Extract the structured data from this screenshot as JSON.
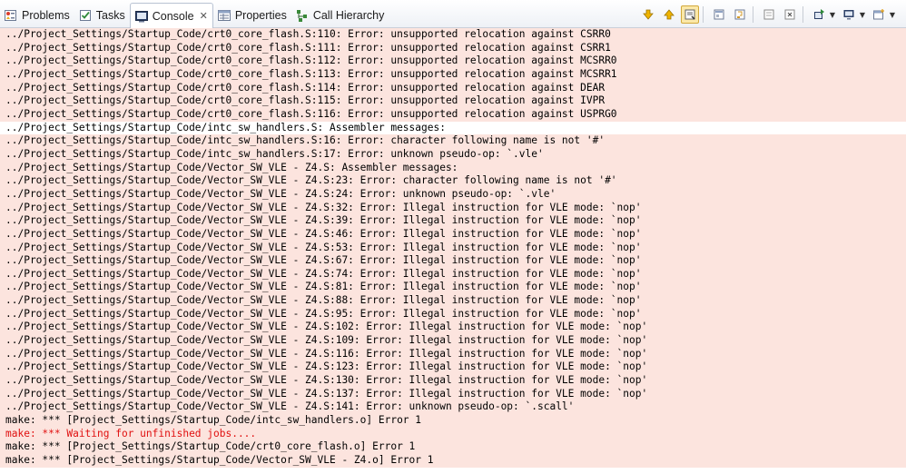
{
  "tabs": [
    {
      "label": "Problems",
      "icon": "problems-icon"
    },
    {
      "label": "Tasks",
      "icon": "tasks-icon"
    },
    {
      "label": "Console",
      "icon": "console-icon",
      "active": true,
      "close": "✕"
    },
    {
      "label": "Properties",
      "icon": "properties-icon"
    },
    {
      "label": "Call Hierarchy",
      "icon": "call-hierarchy-icon"
    }
  ],
  "toolbar": {
    "icons": [
      "scroll-down-icon",
      "scroll-up-icon",
      "scroll-lock-icon",
      "pin-console-icon",
      "word-wrap-icon",
      "clear-console-icon",
      "terminate-icon",
      "open-console-icon",
      "display-console-icon",
      "new-console-icon"
    ]
  },
  "colors": {
    "error_background": "#fce4de",
    "stderr_text": "#e01010",
    "accent": "#d2a93a"
  },
  "console": {
    "lines": [
      {
        "text": "../Project_Settings/Startup_Code/crt0_core_flash.S:110: Error: unsupported relocation against CSRR0",
        "bg": true
      },
      {
        "text": "../Project_Settings/Startup_Code/crt0_core_flash.S:111: Error: unsupported relocation against CSRR1",
        "bg": true
      },
      {
        "text": "../Project_Settings/Startup_Code/crt0_core_flash.S:112: Error: unsupported relocation against MCSRR0",
        "bg": true
      },
      {
        "text": "../Project_Settings/Startup_Code/crt0_core_flash.S:113: Error: unsupported relocation against MCSRR1",
        "bg": true
      },
      {
        "text": "../Project_Settings/Startup_Code/crt0_core_flash.S:114: Error: unsupported relocation against DEAR",
        "bg": true
      },
      {
        "text": "../Project_Settings/Startup_Code/crt0_core_flash.S:115: Error: unsupported relocation against IVPR",
        "bg": true
      },
      {
        "text": "../Project_Settings/Startup_Code/crt0_core_flash.S:116: Error: unsupported relocation against USPRG0",
        "bg": true
      },
      {
        "text": "../Project_Settings/Startup_Code/intc_sw_handlers.S: Assembler messages:",
        "bg": false
      },
      {
        "text": "../Project_Settings/Startup_Code/intc_sw_handlers.S:16: Error: character following name is not '#'",
        "bg": true
      },
      {
        "text": "../Project_Settings/Startup_Code/intc_sw_handlers.S:17: Error: unknown pseudo-op: `.vle'",
        "bg": true
      },
      {
        "text": "../Project_Settings/Startup_Code/Vector_SW_VLE - Z4.S: Assembler messages:",
        "bg": true
      },
      {
        "text": "../Project_Settings/Startup_Code/Vector_SW_VLE - Z4.S:23: Error: character following name is not '#'",
        "bg": true
      },
      {
        "text": "../Project_Settings/Startup_Code/Vector_SW_VLE - Z4.S:24: Error: unknown pseudo-op: `.vle'",
        "bg": true
      },
      {
        "text": "../Project_Settings/Startup_Code/Vector_SW_VLE - Z4.S:32: Error: Illegal instruction for VLE mode: `nop'",
        "bg": true
      },
      {
        "text": "../Project_Settings/Startup_Code/Vector_SW_VLE - Z4.S:39: Error: Illegal instruction for VLE mode: `nop'",
        "bg": true
      },
      {
        "text": "../Project_Settings/Startup_Code/Vector_SW_VLE - Z4.S:46: Error: Illegal instruction for VLE mode: `nop'",
        "bg": true
      },
      {
        "text": "../Project_Settings/Startup_Code/Vector_SW_VLE - Z4.S:53: Error: Illegal instruction for VLE mode: `nop'",
        "bg": true
      },
      {
        "text": "../Project_Settings/Startup_Code/Vector_SW_VLE - Z4.S:67: Error: Illegal instruction for VLE mode: `nop'",
        "bg": true
      },
      {
        "text": "../Project_Settings/Startup_Code/Vector_SW_VLE - Z4.S:74: Error: Illegal instruction for VLE mode: `nop'",
        "bg": true
      },
      {
        "text": "../Project_Settings/Startup_Code/Vector_SW_VLE - Z4.S:81: Error: Illegal instruction for VLE mode: `nop'",
        "bg": true
      },
      {
        "text": "../Project_Settings/Startup_Code/Vector_SW_VLE - Z4.S:88: Error: Illegal instruction for VLE mode: `nop'",
        "bg": true
      },
      {
        "text": "../Project_Settings/Startup_Code/Vector_SW_VLE - Z4.S:95: Error: Illegal instruction for VLE mode: `nop'",
        "bg": true
      },
      {
        "text": "../Project_Settings/Startup_Code/Vector_SW_VLE - Z4.S:102: Error: Illegal instruction for VLE mode: `nop'",
        "bg": true
      },
      {
        "text": "../Project_Settings/Startup_Code/Vector_SW_VLE - Z4.S:109: Error: Illegal instruction for VLE mode: `nop'",
        "bg": true
      },
      {
        "text": "../Project_Settings/Startup_Code/Vector_SW_VLE - Z4.S:116: Error: Illegal instruction for VLE mode: `nop'",
        "bg": true
      },
      {
        "text": "../Project_Settings/Startup_Code/Vector_SW_VLE - Z4.S:123: Error: Illegal instruction for VLE mode: `nop'",
        "bg": true
      },
      {
        "text": "../Project_Settings/Startup_Code/Vector_SW_VLE - Z4.S:130: Error: Illegal instruction for VLE mode: `nop'",
        "bg": true
      },
      {
        "text": "../Project_Settings/Startup_Code/Vector_SW_VLE - Z4.S:137: Error: Illegal instruction for VLE mode: `nop'",
        "bg": true
      },
      {
        "text": "../Project_Settings/Startup_Code/Vector_SW_VLE - Z4.S:141: Error: unknown pseudo-op: `.scall'",
        "bg": true
      },
      {
        "text": "make: *** [Project_Settings/Startup_Code/intc_sw_handlers.o] Error 1",
        "bg": true
      },
      {
        "text": "make: *** Waiting for unfinished jobs....",
        "bg": true,
        "red": true
      },
      {
        "text": "make: *** [Project_Settings/Startup_Code/crt0_core_flash.o] Error 1",
        "bg": true
      },
      {
        "text": "make: *** [Project_Settings/Startup_Code/Vector_SW_VLE - Z4.o] Error 1",
        "bg": true
      }
    ]
  }
}
